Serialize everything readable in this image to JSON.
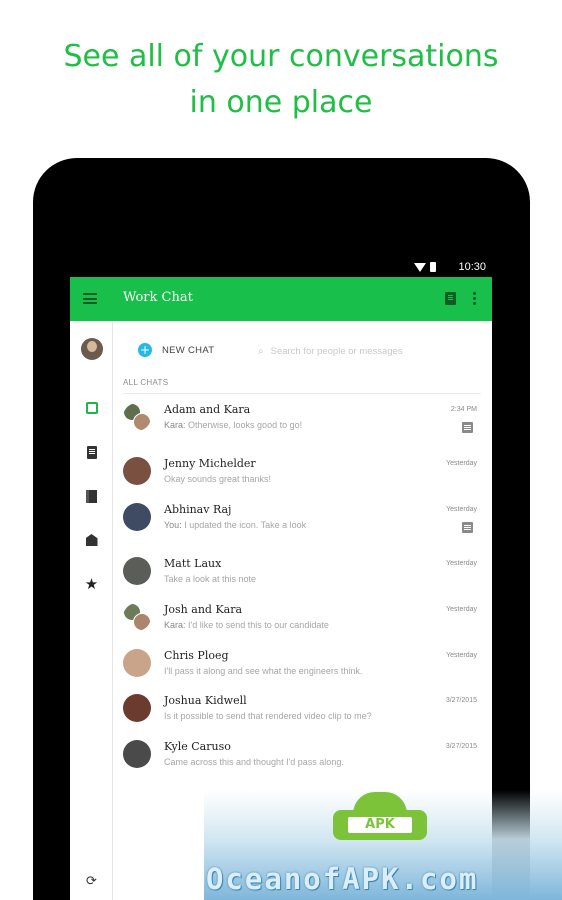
{
  "promo": {
    "headline_line1": "See all of your conversations",
    "headline_line2": "in one place",
    "headline_color": "#1fbf45"
  },
  "status_bar": {
    "time": "10:30",
    "icons": [
      "wifi-icon",
      "battery-icon"
    ]
  },
  "app_bar": {
    "title": "Work Chat",
    "color": "#18c04b",
    "icons": [
      "menu-icon",
      "new-note-icon",
      "more-vert-icon"
    ]
  },
  "sidebar": {
    "items": [
      {
        "icon": "user-avatar"
      },
      {
        "icon": "chat-icon",
        "active": true
      },
      {
        "icon": "note-icon"
      },
      {
        "icon": "notebook-icon"
      },
      {
        "icon": "tag-icon"
      },
      {
        "icon": "star-icon",
        "glyph": "★"
      },
      {
        "icon": "sync-icon",
        "glyph": "⟳"
      }
    ]
  },
  "toolbar": {
    "new_chat_label": "NEW CHAT",
    "search_placeholder": "Search for people or messages"
  },
  "chats": {
    "section_label": "ALL CHATS",
    "items": [
      {
        "name": "Adam and Kara",
        "sender": "Kara:",
        "message": "Otherwise, looks good to go!",
        "time": "2:34 PM",
        "note": true
      },
      {
        "name": "Jenny Michelder",
        "sender": "",
        "message": "Okay sounds great thanks!",
        "time": "Yesterday",
        "note": false
      },
      {
        "name": "Abhinav Raj",
        "sender": "You:",
        "message": "I updated the icon. Take a look",
        "time": "Yesterday",
        "note": true
      },
      {
        "name": "Matt Laux",
        "sender": "",
        "message": "Take a look at this note",
        "time": "Yesterday",
        "note": false
      },
      {
        "name": "Josh and Kara",
        "sender": "Kara:",
        "message": "I'd like to send this to our candidate",
        "time": "Yesterday",
        "note": false
      },
      {
        "name": "Chris Ploeg",
        "sender": "",
        "message": "I'll pass it along and see what the engineers think.",
        "time": "Yesterday",
        "note": false
      },
      {
        "name": "Joshua Kidwell",
        "sender": "",
        "message": "Is it possible to send that rendered video clip to me?",
        "time": "3/27/2015",
        "note": false
      },
      {
        "name": "Kyle Caruso",
        "sender": "",
        "message": "Came across this and thought I'd pass along.",
        "time": "3/27/2015",
        "note": false
      }
    ]
  },
  "watermark": {
    "badge_text": "APK",
    "site_text": "OceanofAPK.com"
  }
}
